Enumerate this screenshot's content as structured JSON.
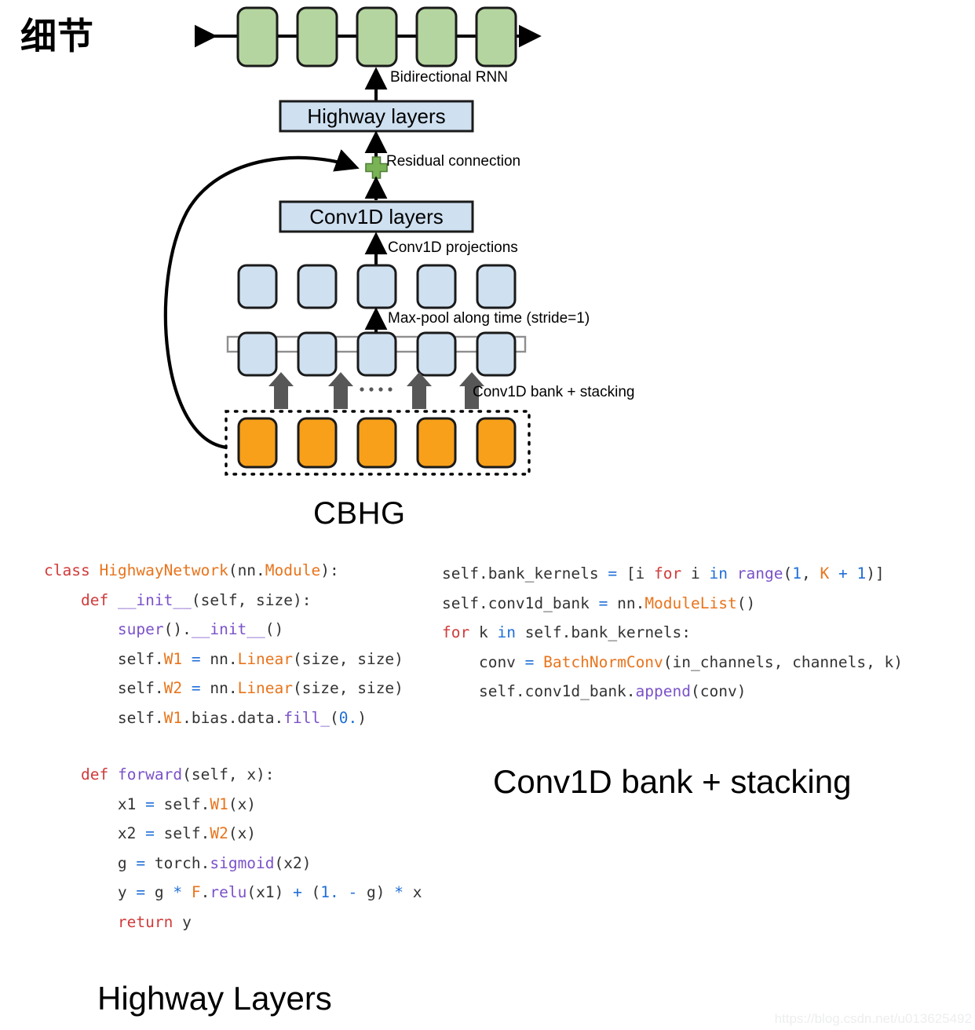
{
  "page": {
    "heading_cn": "细节",
    "watermark": "https://blog.csdn.net/u013625492"
  },
  "diagram": {
    "name": "CBHG module architecture",
    "caption": "CBHG",
    "blocks": {
      "highway_layers": "Highway layers",
      "conv1d_layers": "Conv1D layers"
    },
    "annotations": {
      "bidirectional_rnn": "Bidirectional RNN",
      "residual_connection": "Residual connection",
      "conv1d_projections": "Conv1D projections",
      "max_pool": "Max-pool along time (stride=1)",
      "conv1d_bank": "Conv1D bank + stacking"
    },
    "colors": {
      "rnn_green_fill": "#b5d5a0",
      "rnn_green_stroke": "#1a1a1a",
      "block_blue_fill": "#cfe0f0",
      "block_blue_stroke": "#1a1a1a",
      "cell_blue_fill": "#cfe0f0",
      "input_orange_fill": "#f8a01a",
      "input_orange_stroke": "#1a1a1a",
      "plus_green": "#79b356",
      "arrow_grey": "#575757",
      "line_black": "#000000"
    },
    "counts": {
      "rnn_cells": 5,
      "projection_cells": 5,
      "bank_cells": 5,
      "input_cells": 5,
      "stack_arrows": 4
    }
  },
  "code_highway": {
    "caption": "Highway Layers",
    "lines": [
      "class HighwayNetwork(nn.Module):",
      "    def __init__(self, size):",
      "        super().__init__()",
      "        self.W1 = nn.Linear(size, size)",
      "        self.W2 = nn.Linear(size, size)",
      "        self.W1.bias.data.fill_(0.)",
      "",
      "    def forward(self, x):",
      "        x1 = self.W1(x)",
      "        x2 = self.W2(x)",
      "        g = torch.sigmoid(x2)",
      "        y = g * F.relu(x1) + (1. - g) * x",
      "        return y"
    ]
  },
  "code_convbank": {
    "caption": "Conv1D bank + stacking",
    "lines": [
      "self.bank_kernels = [i for i in range(1, K + 1)]",
      "self.conv1d_bank = nn.ModuleList()",
      "for k in self.bank_kernels:",
      "    conv = BatchNormConv(in_channels, channels, k)",
      "    self.conv1d_bank.append(conv)"
    ]
  }
}
